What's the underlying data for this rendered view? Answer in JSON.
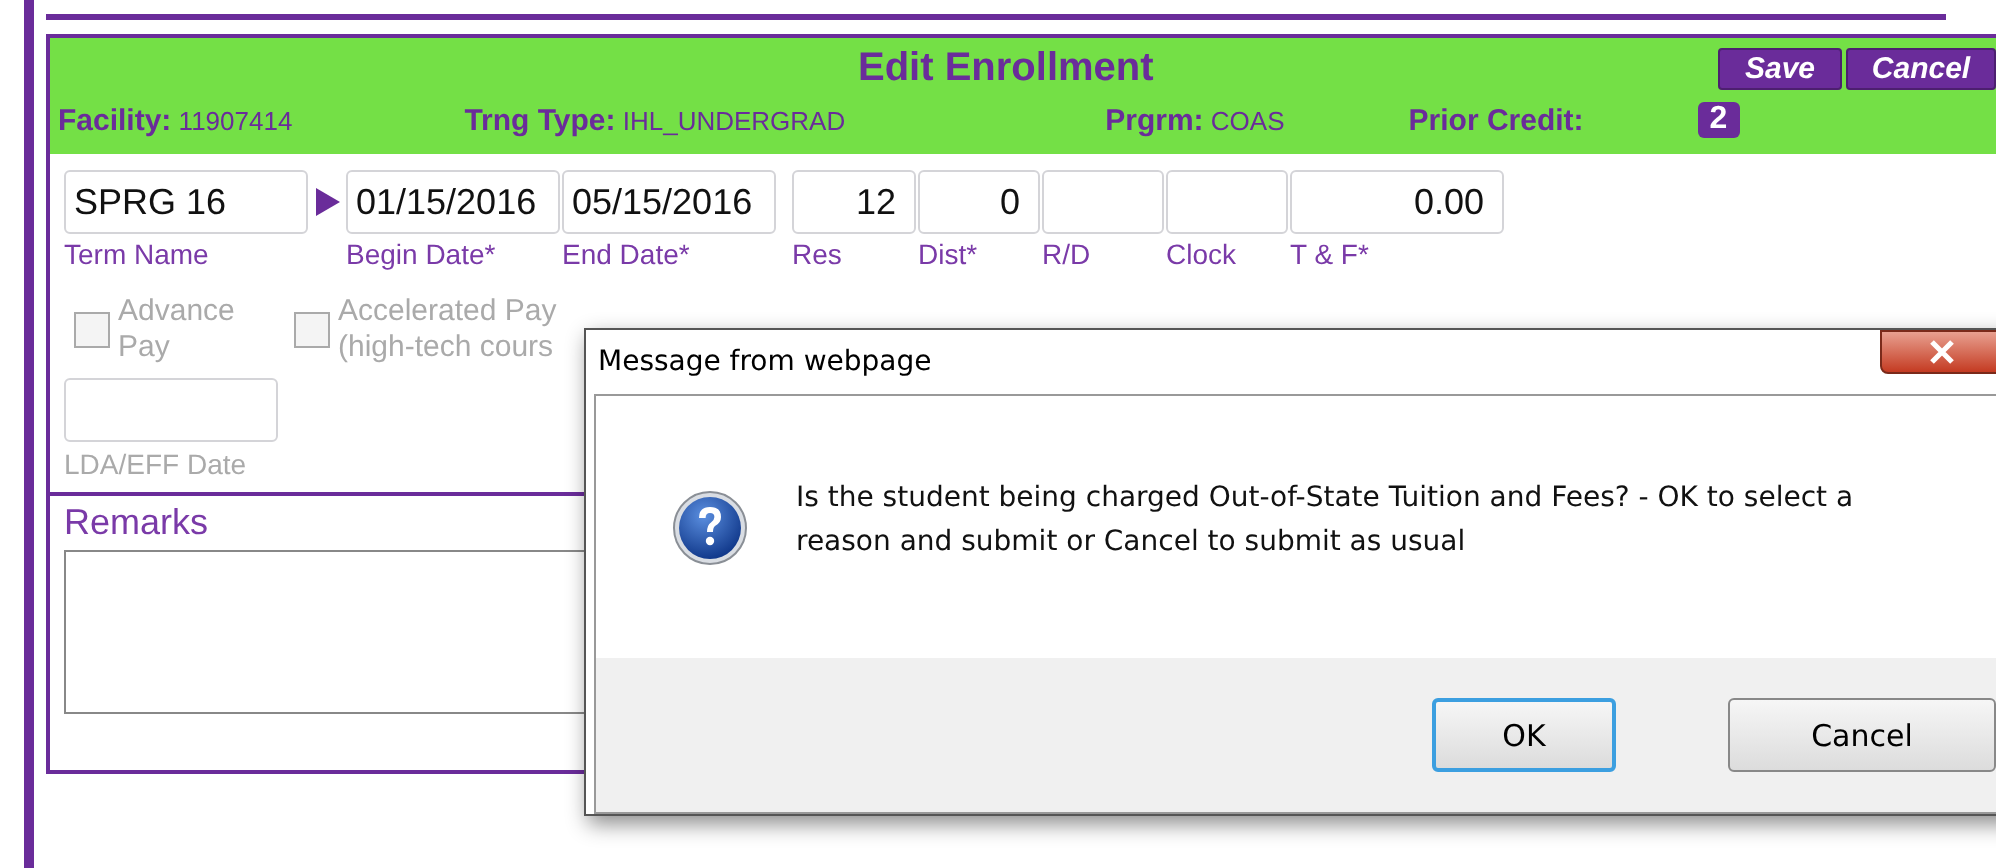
{
  "header": {
    "title": "Edit Enrollment",
    "buttons": [
      {
        "label": "Save"
      },
      {
        "label": "Cancel"
      }
    ],
    "info": [
      {
        "label": "Facility:",
        "value": "11907414"
      },
      {
        "label": "Trng Type:",
        "value": "IHL_UNDERGRAD"
      },
      {
        "label": "Prgrm:",
        "value": "COAS"
      }
    ],
    "prior_credit": {
      "label": "Prior Credit:",
      "value": "2"
    }
  },
  "fields": [
    {
      "label": "Term Name",
      "value": "SPRG 16",
      "kind": "text"
    },
    {
      "label": "Begin Date*",
      "value": "01/15/2016",
      "kind": "text"
    },
    {
      "label": "End Date*",
      "value": "05/15/2016",
      "kind": "text"
    },
    {
      "label": "Res",
      "value": "12",
      "kind": "number"
    },
    {
      "label": "Dist*",
      "value": "0",
      "kind": "number"
    },
    {
      "label": "R/D",
      "kind": "number"
    },
    {
      "label": "Clock",
      "kind": "number"
    },
    {
      "label": "T & F*",
      "value": "0.00",
      "kind": "number"
    }
  ],
  "checkboxes": [
    {
      "label": "Advance Pay",
      "checked": false,
      "disabled": true
    },
    {
      "label": "Accelerated Pay (high-tech cours",
      "checked": false,
      "disabled": true
    }
  ],
  "lda": {
    "label": "LDA/EFF Date"
  },
  "remarks": {
    "label": "Remarks"
  },
  "dialog": {
    "title": "Message from webpage",
    "message": "Is the student being charged Out-of-State Tuition and Fees? - OK to select a reason and submit or Cancel to submit as usual",
    "buttons": [
      {
        "label": "OK",
        "focused": true
      },
      {
        "label": "Cancel",
        "focused": false
      }
    ]
  }
}
